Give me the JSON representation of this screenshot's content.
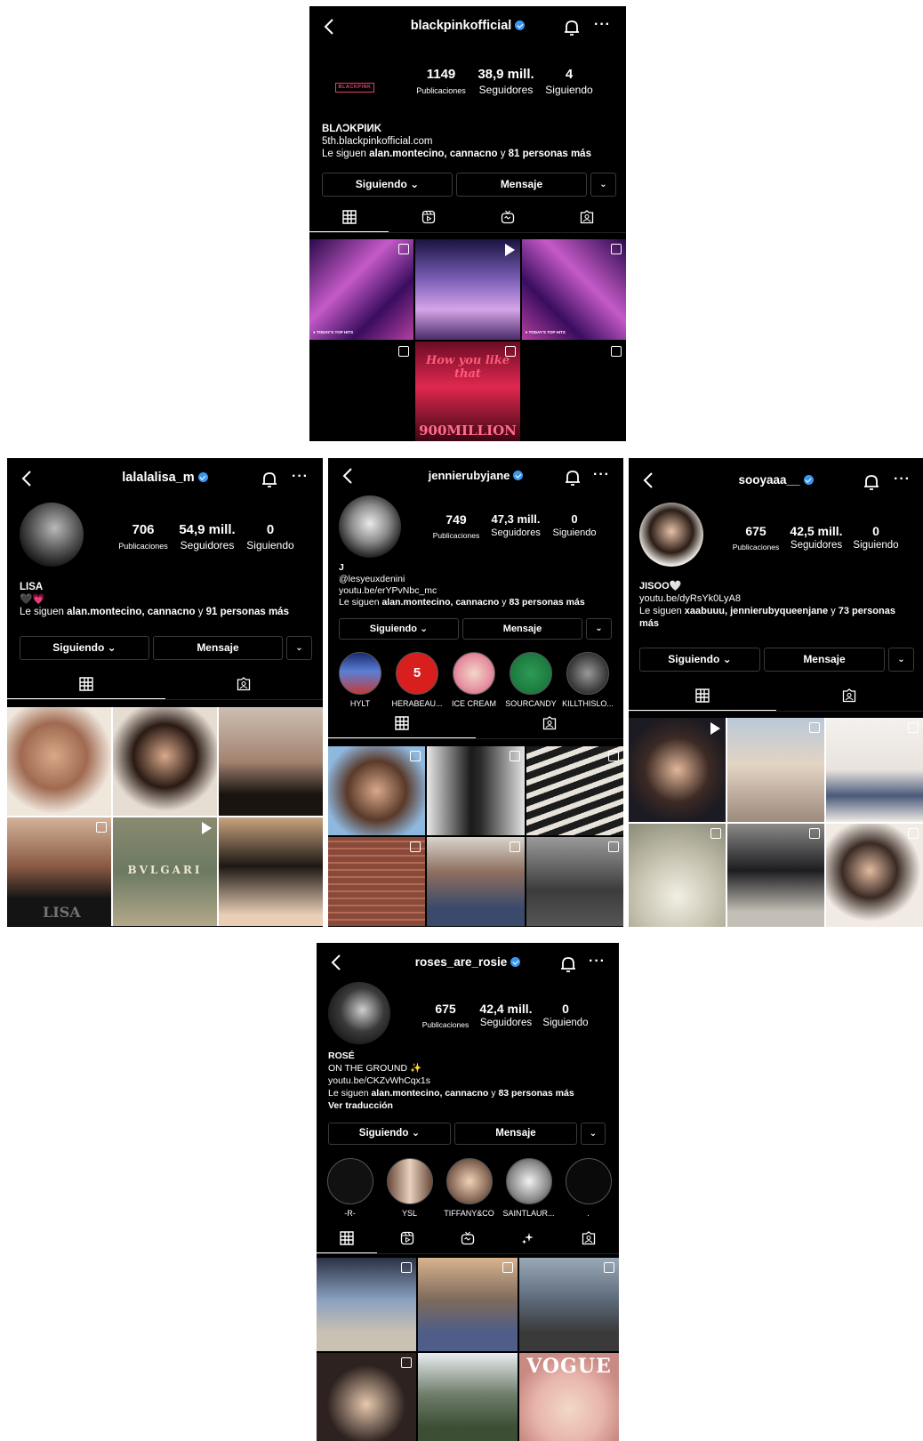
{
  "common": {
    "follow_button": "Siguiendo",
    "message_button": "Mensaje",
    "posts_label": "Publicaciones",
    "followers_label": "Seguidores",
    "following_label": "Siguiendo"
  },
  "p1": {
    "username": "blackpinkofficial",
    "posts": "1149",
    "followers": "38,9 mill.",
    "following": "4",
    "logo_text": "BLACKPINK",
    "display_name": "BLΛƆKPIИK",
    "link": "5th.blackpinkofficial.com",
    "followed_prefix": "Le siguen ",
    "followed_names": "alan.montecino, cannacno",
    "followed_mid": " y ",
    "followed_rest": "81 personas más",
    "grid_caption_left": "● TODAY'S TOP HITS",
    "grid_caption_right": "● TODAY'S TOP HITS",
    "grid_title": "How you like that",
    "grid_subtitle": "900MILLION"
  },
  "p2": {
    "username": "lalalalisa_m",
    "posts": "706",
    "followers": "54,9 mill.",
    "following": "0",
    "display_name": "LISA",
    "emoji": "🖤💗",
    "followed_prefix": "Le siguen ",
    "followed_names": "alan.montecino, cannacno",
    "followed_mid": " y ",
    "followed_rest": "91 personas más",
    "grid_text": "BVLGARI",
    "grid_text2": "LISA"
  },
  "p3": {
    "username": "jennierubyjane",
    "posts": "749",
    "followers": "47,3 mill.",
    "following": "0",
    "display_name": "J",
    "handle": "@lesyeuxdenini",
    "link": "youtu.be/erYPvNbc_mc",
    "followed_prefix": "Le siguen ",
    "followed_names": "alan.montecino, cannacno",
    "followed_mid": " y ",
    "followed_rest": "83 personas más",
    "highlights": [
      "HYLT",
      "HERABEAU...",
      "ICE CREAM",
      "SOURCANDY",
      "KILLTHISLO..."
    ],
    "highlight_5": "5"
  },
  "p4": {
    "username": "sooyaaa__",
    "posts": "675",
    "followers": "42,5 mill.",
    "following": "0",
    "display_name": "JISOO🤍",
    "link": "youtu.be/dyRsYk0LyA8",
    "followed_prefix": "Le siguen ",
    "followed_names": "xaabuuu, jennierubyqueenjane",
    "followed_mid": " y ",
    "followed_rest": "73 personas más"
  },
  "p5": {
    "username": "roses_are_rosie",
    "posts": "675",
    "followers": "42,4 mill.",
    "following": "0",
    "display_name": "ROSÉ",
    "tagline": "ON THE GROUND ✨",
    "link": "youtu.be/CKZvWhCqx1s",
    "followed_prefix": "Le siguen ",
    "followed_names": "alan.montecino, cannacno",
    "followed_mid": " y ",
    "followed_rest": "83 personas más",
    "translate": "Ver traducción",
    "highlights": [
      "-R-",
      "YSL",
      "TIFFANY&CO",
      "SAINTLAUR...",
      "."
    ],
    "grid_text": "VOGUE"
  },
  "colors": {
    "background": "#000000",
    "verified": "#3897f0",
    "border": "#3a3a3a"
  }
}
